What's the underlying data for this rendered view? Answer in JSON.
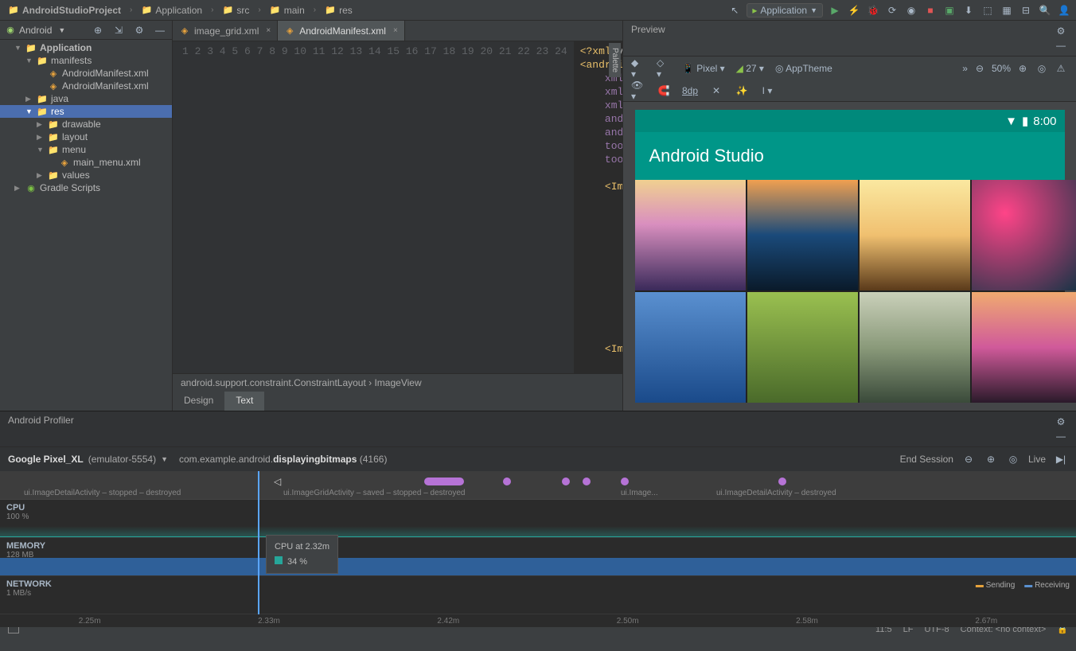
{
  "nav": {
    "crumbs": [
      "AndroidStudioProject",
      "Application",
      "src",
      "main",
      "res"
    ],
    "run_config": "Application"
  },
  "project": {
    "selector": "Android",
    "tree": {
      "root": "Application",
      "manifests": "manifests",
      "manifest1": "AndroidManifest.xml",
      "manifest2": "AndroidManifest.xml",
      "java": "java",
      "res": "res",
      "drawable": "drawable",
      "layout": "layout",
      "menu": "menu",
      "main_menu": "main_menu.xml",
      "values": "values",
      "gradle": "Gradle Scripts"
    }
  },
  "tabs": {
    "t1": "image_grid.xml",
    "t2": "AndroidManifest.xml"
  },
  "editor": {
    "crumb": "android.support.constraint.ConstraintLayout    ›    ImageView",
    "design": "Design",
    "text": "Text"
  },
  "code": {
    "lines": [
      "1",
      "2",
      "3",
      "4",
      "5",
      "6",
      "7",
      "8",
      "9",
      "10",
      "11",
      "12",
      "13",
      "14",
      "15",
      "16",
      "17",
      "18",
      "19",
      "20",
      "21",
      "22",
      "23",
      "24"
    ]
  },
  "preview": {
    "title": "Preview",
    "device": "Pixel",
    "api": "27",
    "theme": "AppTheme",
    "zoom": "50%",
    "dp": "8dp",
    "statusbar_time": "8:00",
    "app_title": "Android Studio"
  },
  "profiler": {
    "title": "Android Profiler",
    "device": "Google Pixel_XL",
    "emulator": "(emulator-5554)",
    "package": "com.example.android.",
    "package_bold": "displayingbitmaps",
    "pid": "(4166)",
    "end": "End Session",
    "live": "Live",
    "events": {
      "e1": "ui.ImageDetailActivity – stopped – destroyed",
      "e2": "ui.ImageGridActivity – saved – stopped – destroyed",
      "e3": "ui.Image...",
      "e4": "ui.ImageDetailActivity – destroyed"
    },
    "cpu": {
      "label": "CPU",
      "sub": "100 %"
    },
    "memory": {
      "label": "MEMORY",
      "sub": "128 MB"
    },
    "network": {
      "label": "NETWORK",
      "sub": "1 MB/s",
      "sending": "Sending",
      "receiving": "Receiving"
    },
    "tooltip": {
      "title": "CPU at 2.32m",
      "val": "34 %"
    },
    "ticks": [
      "2.25m",
      "2.33m",
      "2.42m",
      "2.50m",
      "2.58m",
      "2.67m"
    ]
  },
  "status": {
    "pos": "11:5",
    "lf": "LF",
    "enc": "UTF-8",
    "context": "Context: <no context>"
  }
}
